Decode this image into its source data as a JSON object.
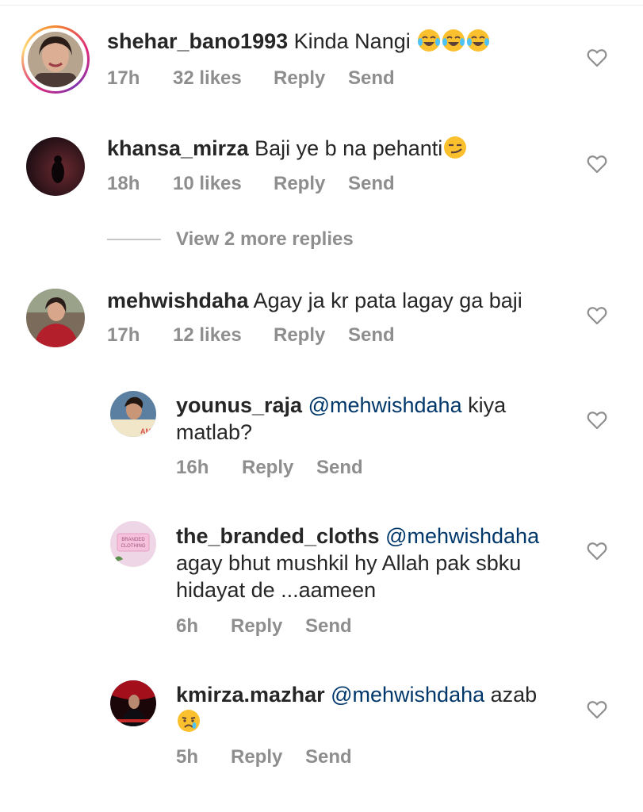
{
  "comments": [
    {
      "username": "shehar_bano1993",
      "text": " Kinda Nangi",
      "emojis": [
        "face-with-tears-of-joy",
        "face-with-tears-of-joy",
        "face-with-tears-of-joy"
      ],
      "time": "17h",
      "likes": "32 likes",
      "reply": "Reply",
      "send": "Send",
      "has_story_ring": true
    },
    {
      "username": "khansa_mirza",
      "text": " Baji ye b na pehanti",
      "emojis": [
        "smirking-face"
      ],
      "time": "18h",
      "likes": "10 likes",
      "reply": "Reply",
      "send": "Send"
    },
    {
      "username": "mehwishdaha",
      "text": " Agay ja kr pata lagay ga baji",
      "time": "17h",
      "likes": "12 likes",
      "reply": "Reply",
      "send": "Send"
    }
  ],
  "view_more_replies": "View 2 more replies",
  "replies": [
    {
      "username": "younus_raja",
      "mention": "@mehwishdaha",
      "text_line1": " kiya",
      "text_line2": "matlab?",
      "time": "16h",
      "reply": "Reply",
      "send": "Send"
    },
    {
      "username": "the_branded_cloths",
      "mention": "@mehwishdaha",
      "text_line2": "agay bhut mushkil hy Allah pak sbku",
      "text_line3": "hidayat de ...aameen",
      "avatar_text": "BRANDED CLOTHING",
      "time": "6h",
      "reply": "Reply",
      "send": "Send"
    },
    {
      "username": "kmirza.mazhar",
      "mention": "@mehwishdaha",
      "text_line1": " azab",
      "emojis": [
        "crying-face"
      ],
      "time": "5h",
      "reply": "Reply",
      "send": "Send"
    }
  ],
  "icons": {
    "like": "heart-outline-icon"
  },
  "colors": {
    "text": "#262626",
    "secondary": "#8e8e8e",
    "mention": "#00376b",
    "divider": "#c7c7c7"
  }
}
